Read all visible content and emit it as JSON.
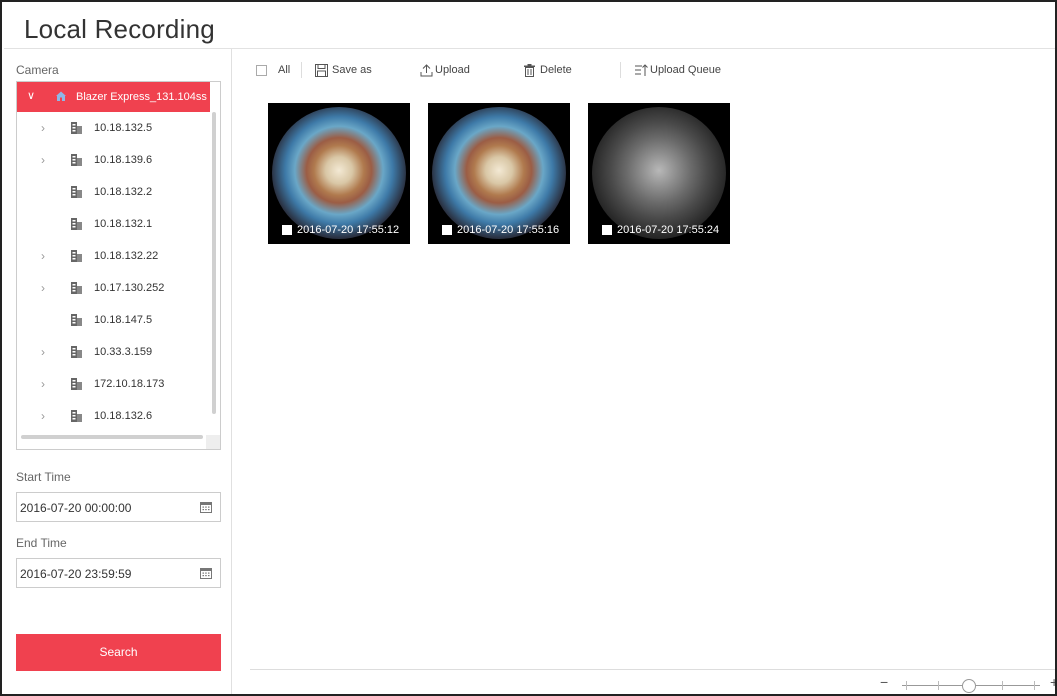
{
  "page": {
    "title": "Local Recording"
  },
  "camera": {
    "label": "Camera",
    "root": {
      "label": "Blazer Express_131.104ss",
      "icon": "home-icon",
      "expanded": true
    },
    "items": [
      {
        "label": "10.18.132.5",
        "expandable": true
      },
      {
        "label": "10.18.139.6",
        "expandable": true
      },
      {
        "label": "10.18.132.2",
        "expandable": false
      },
      {
        "label": "10.18.132.1",
        "expandable": false
      },
      {
        "label": "10.18.132.22",
        "expandable": true
      },
      {
        "label": "10.17.130.252",
        "expandable": true
      },
      {
        "label": "10.18.147.5",
        "expandable": false
      },
      {
        "label": "10.33.3.159",
        "expandable": true
      },
      {
        "label": "172.10.18.173",
        "expandable": true
      },
      {
        "label": "10.18.132.6",
        "expandable": true
      }
    ]
  },
  "start_time": {
    "label": "Start Time",
    "value": "2016-07-20 00:00:00"
  },
  "end_time": {
    "label": "End Time",
    "value": "2016-07-20 23:59:59"
  },
  "search": {
    "label": "Search"
  },
  "toolbar": {
    "all": "All",
    "save_as": "Save as",
    "upload": "Upload",
    "delete": "Delete",
    "upload_queue": "Upload Queue"
  },
  "recordings": [
    {
      "timestamp": "2016-07-20 17:55:12",
      "mode": "color"
    },
    {
      "timestamp": "2016-07-20 17:55:16",
      "mode": "color"
    },
    {
      "timestamp": "2016-07-20 17:55:24",
      "mode": "night"
    }
  ],
  "zoom": {
    "minus": "−",
    "plus": "+",
    "level": 0.45
  },
  "colors": {
    "accent": "#f0414f"
  }
}
